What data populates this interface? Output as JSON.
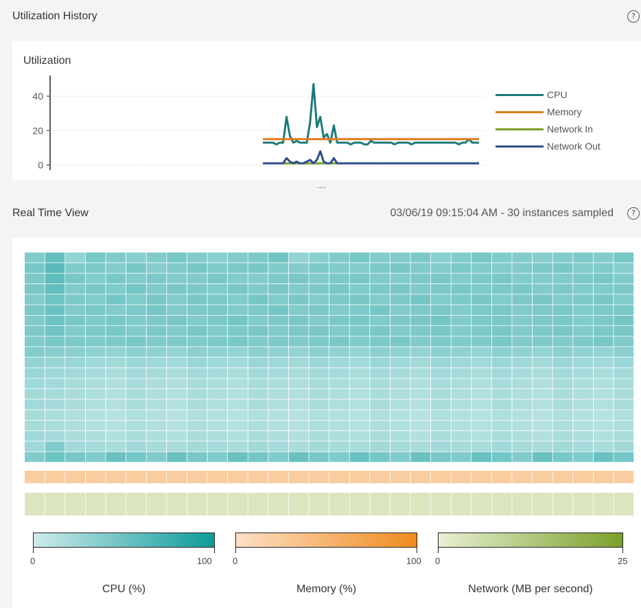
{
  "history": {
    "section_title": "Utilization History",
    "help_glyph": "?"
  },
  "realtime": {
    "section_title": "Real Time View",
    "info": "03/06/19 09:15:04 AM - 30 instances sampled",
    "help_glyph": "?"
  },
  "splitter": "....",
  "chart_data": [
    {
      "type": "line",
      "title": "Utilization",
      "ylim": [
        -3,
        52
      ],
      "yticks": [
        0,
        20,
        40
      ],
      "grid": true,
      "legend_position": "right",
      "x": [
        0,
        1,
        2,
        3,
        4,
        5,
        6,
        7,
        8,
        9,
        10,
        11,
        12,
        13,
        14,
        15,
        16,
        17,
        18,
        19,
        20,
        21,
        22,
        23,
        24,
        25,
        26,
        27,
        28,
        29,
        30,
        31,
        32,
        33,
        34,
        35,
        36,
        37,
        38,
        39,
        40,
        41,
        42,
        43,
        44,
        45,
        46,
        47,
        48,
        49,
        50,
        51,
        52,
        53,
        54,
        55,
        56,
        57,
        58,
        59,
        60,
        61,
        62,
        63,
        64
      ],
      "series": [
        {
          "name": "CPU",
          "color": "#1a7a7a",
          "values": [
            13,
            13,
            13,
            13,
            12,
            13,
            13,
            28,
            17,
            13,
            14,
            13,
            13,
            13,
            25,
            47,
            22,
            28,
            16,
            18,
            13,
            23,
            13,
            13,
            13,
            13,
            12,
            13,
            13,
            13,
            12,
            12,
            14,
            13,
            13,
            13,
            13,
            13,
            13,
            12,
            13,
            13,
            13,
            13,
            12,
            13,
            13,
            13,
            13,
            13,
            13,
            13,
            13,
            13,
            13,
            13,
            13,
            13,
            12,
            13,
            13,
            15,
            13,
            13,
            13
          ]
        },
        {
          "name": "Memory",
          "color": "#e07b1a",
          "values": [
            15,
            15,
            15,
            15,
            15,
            15,
            15,
            15,
            15,
            15,
            15,
            15,
            15,
            15,
            15,
            15,
            15,
            15,
            15,
            15,
            15,
            15,
            15,
            15,
            15,
            15,
            15,
            15,
            15,
            15,
            15,
            15,
            15,
            15,
            15,
            15,
            15,
            15,
            15,
            15,
            15,
            15,
            15,
            15,
            15,
            15,
            15,
            15,
            15,
            15,
            15,
            15,
            15,
            15,
            15,
            15,
            15,
            15,
            15,
            15,
            15,
            15,
            15,
            15,
            15
          ]
        },
        {
          "name": "Network In",
          "color": "#7aa02a",
          "values": [
            1,
            1,
            1,
            1,
            1,
            1,
            1,
            1,
            1,
            1,
            1,
            1,
            1,
            1,
            1,
            1,
            1,
            1,
            1,
            1,
            1,
            1,
            1,
            1,
            1,
            1,
            1,
            1,
            1,
            1,
            1,
            1,
            1,
            1,
            1,
            1,
            1,
            1,
            1,
            1,
            1,
            1,
            1,
            1,
            1,
            1,
            1,
            1,
            1,
            1,
            1,
            1,
            1,
            1,
            1,
            1,
            1,
            1,
            1,
            1,
            1,
            1,
            1,
            1,
            1
          ]
        },
        {
          "name": "Network Out",
          "color": "#2f4d8c",
          "values": [
            1,
            1,
            1,
            1,
            1,
            1,
            1,
            4,
            2,
            1,
            2,
            1,
            1,
            2,
            3,
            1,
            3,
            8,
            2,
            1,
            1,
            4,
            1,
            1,
            1,
            1,
            1,
            1,
            1,
            1,
            1,
            1,
            1,
            1,
            1,
            1,
            1,
            1,
            1,
            1,
            1,
            1,
            1,
            1,
            1,
            1,
            1,
            1,
            1,
            1,
            1,
            1,
            1,
            1,
            1,
            1,
            1,
            1,
            1,
            1,
            1,
            1,
            1,
            1,
            1
          ]
        }
      ]
    },
    {
      "type": "heatmap",
      "metric": "CPU (%)",
      "columns": 30,
      "rows": 20,
      "range": [
        0,
        100
      ],
      "color_low": "#cdebeb",
      "color_high": "#0e9a9a",
      "values": [
        [
          40,
          55,
          30,
          45,
          40,
          35,
          40,
          45,
          40,
          35,
          38,
          42,
          48,
          30,
          35,
          40,
          45,
          38,
          40,
          42,
          35,
          40,
          45,
          40,
          38,
          36,
          40,
          42,
          38,
          44
        ],
        [
          45,
          60,
          40,
          42,
          38,
          44,
          36,
          40,
          45,
          40,
          42,
          44,
          40,
          38,
          42,
          40,
          38,
          42,
          44,
          40,
          38,
          42,
          40,
          38,
          40,
          42,
          44,
          38,
          40,
          36
        ],
        [
          42,
          58,
          45,
          40,
          44,
          40,
          42,
          38,
          40,
          44,
          40,
          38,
          42,
          44,
          40,
          42,
          44,
          40,
          38,
          42,
          44,
          40,
          42,
          44,
          40,
          38,
          40,
          42,
          44,
          40
        ],
        [
          44,
          56,
          40,
          44,
          40,
          46,
          40,
          44,
          42,
          40,
          44,
          40,
          44,
          40,
          42,
          44,
          40,
          42,
          44,
          40,
          42,
          44,
          40,
          42,
          44,
          40,
          42,
          40,
          40,
          42
        ],
        [
          40,
          50,
          42,
          40,
          46,
          40,
          44,
          40,
          44,
          42,
          40,
          46,
          40,
          44,
          40,
          42,
          44,
          40,
          42,
          46,
          40,
          42,
          44,
          40,
          42,
          44,
          40,
          42,
          44,
          40
        ],
        [
          44,
          52,
          40,
          44,
          40,
          42,
          46,
          40,
          42,
          44,
          40,
          42,
          46,
          40,
          44,
          40,
          42,
          46,
          40,
          42,
          44,
          40,
          42,
          44,
          40,
          42,
          44,
          40,
          42,
          44
        ],
        [
          40,
          50,
          44,
          40,
          44,
          40,
          42,
          44,
          40,
          42,
          46,
          40,
          42,
          44,
          40,
          42,
          44,
          40,
          42,
          44,
          46,
          40,
          42,
          44,
          40,
          42,
          44,
          40,
          42,
          46
        ],
        [
          42,
          48,
          40,
          42,
          44,
          40,
          42,
          40,
          44,
          40,
          42,
          44,
          40,
          42,
          44,
          40,
          42,
          44,
          40,
          42,
          44,
          40,
          42,
          44,
          40,
          42,
          44,
          40,
          42,
          44
        ],
        [
          40,
          44,
          42,
          40,
          42,
          44,
          40,
          42,
          40,
          42,
          44,
          40,
          42,
          40,
          42,
          44,
          40,
          42,
          44,
          40,
          42,
          40,
          42,
          44,
          40,
          42,
          40,
          42,
          44,
          40
        ],
        [
          38,
          36,
          34,
          32,
          30,
          34,
          32,
          30,
          34,
          32,
          30,
          34,
          32,
          30,
          34,
          32,
          30,
          34,
          32,
          30,
          34,
          32,
          30,
          34,
          32,
          30,
          34,
          32,
          30,
          34
        ],
        [
          30,
          28,
          26,
          24,
          22,
          26,
          24,
          22,
          26,
          24,
          22,
          26,
          24,
          22,
          26,
          24,
          22,
          26,
          24,
          22,
          26,
          24,
          22,
          26,
          24,
          22,
          26,
          24,
          22,
          26
        ],
        [
          26,
          24,
          22,
          20,
          18,
          22,
          20,
          18,
          22,
          20,
          18,
          22,
          20,
          18,
          22,
          20,
          18,
          22,
          20,
          18,
          22,
          20,
          18,
          22,
          20,
          18,
          22,
          20,
          18,
          22
        ],
        [
          24,
          22,
          20,
          18,
          16,
          20,
          18,
          16,
          20,
          18,
          16,
          20,
          18,
          16,
          20,
          18,
          16,
          20,
          18,
          16,
          20,
          18,
          16,
          20,
          18,
          16,
          20,
          18,
          16,
          20
        ],
        [
          22,
          20,
          18,
          16,
          14,
          18,
          16,
          14,
          18,
          16,
          14,
          18,
          16,
          14,
          18,
          16,
          14,
          18,
          16,
          14,
          18,
          16,
          14,
          18,
          16,
          14,
          18,
          16,
          14,
          18
        ],
        [
          22,
          20,
          18,
          16,
          14,
          18,
          16,
          14,
          18,
          16,
          14,
          18,
          16,
          14,
          18,
          16,
          14,
          18,
          16,
          14,
          18,
          16,
          14,
          18,
          16,
          14,
          18,
          16,
          14,
          18
        ],
        [
          20,
          18,
          16,
          14,
          12,
          16,
          14,
          12,
          16,
          14,
          12,
          16,
          14,
          12,
          16,
          14,
          12,
          16,
          14,
          12,
          16,
          14,
          12,
          16,
          14,
          12,
          16,
          14,
          12,
          16
        ],
        [
          20,
          18,
          16,
          14,
          12,
          16,
          14,
          12,
          16,
          14,
          12,
          16,
          14,
          12,
          16,
          14,
          12,
          16,
          14,
          12,
          16,
          14,
          12,
          16,
          14,
          12,
          16,
          14,
          12,
          16
        ],
        [
          22,
          20,
          18,
          16,
          14,
          18,
          16,
          14,
          18,
          16,
          14,
          18,
          16,
          14,
          18,
          16,
          14,
          18,
          16,
          14,
          18,
          16,
          14,
          18,
          16,
          14,
          18,
          16,
          14,
          18
        ],
        [
          24,
          40,
          22,
          20,
          18,
          22,
          20,
          18,
          22,
          20,
          18,
          22,
          20,
          18,
          22,
          20,
          18,
          22,
          20,
          18,
          22,
          20,
          18,
          22,
          20,
          18,
          22,
          20,
          18,
          22
        ],
        [
          40,
          50,
          44,
          40,
          52,
          46,
          40,
          52,
          44,
          40,
          52,
          46,
          40,
          52,
          44,
          40,
          52,
          46,
          40,
          52,
          44,
          40,
          52,
          46,
          40,
          52,
          44,
          40,
          52,
          46
        ]
      ]
    },
    {
      "type": "heatmap",
      "metric": "Memory (%)",
      "columns": 30,
      "rows": 1,
      "range": [
        0,
        100
      ],
      "color_low": "#fde0c5",
      "color_high": "#ef8a1e",
      "values": [
        [
          22,
          22,
          22,
          22,
          22,
          22,
          22,
          22,
          22,
          22,
          22,
          22,
          22,
          22,
          22,
          22,
          22,
          22,
          22,
          22,
          22,
          22,
          22,
          22,
          22,
          22,
          22,
          22,
          22,
          22
        ]
      ]
    },
    {
      "type": "heatmap",
      "metric": "Network (MB per second)",
      "columns": 30,
      "rows": 1,
      "range": [
        0,
        25
      ],
      "color_low": "#e8f0d4",
      "color_high": "#7aa02a",
      "values": [
        [
          3,
          3,
          3,
          3,
          3,
          3,
          3,
          3,
          3,
          3,
          3,
          3,
          3,
          3,
          3,
          3,
          3,
          3,
          3,
          3,
          3,
          3,
          3,
          3,
          3,
          3,
          3,
          3,
          3,
          3
        ]
      ]
    }
  ],
  "scales": [
    {
      "label": "CPU (%)",
      "min": "0",
      "max": "100",
      "color_low": "#cdebeb",
      "color_high": "#0e9a9a"
    },
    {
      "label": "Memory (%)",
      "min": "0",
      "max": "100",
      "color_low": "#fde0c5",
      "color_high": "#ef8a1e"
    },
    {
      "label": "Network (MB per second)",
      "min": "0",
      "max": "25",
      "color_low": "#e8f0d4",
      "color_high": "#7aa02a"
    }
  ]
}
